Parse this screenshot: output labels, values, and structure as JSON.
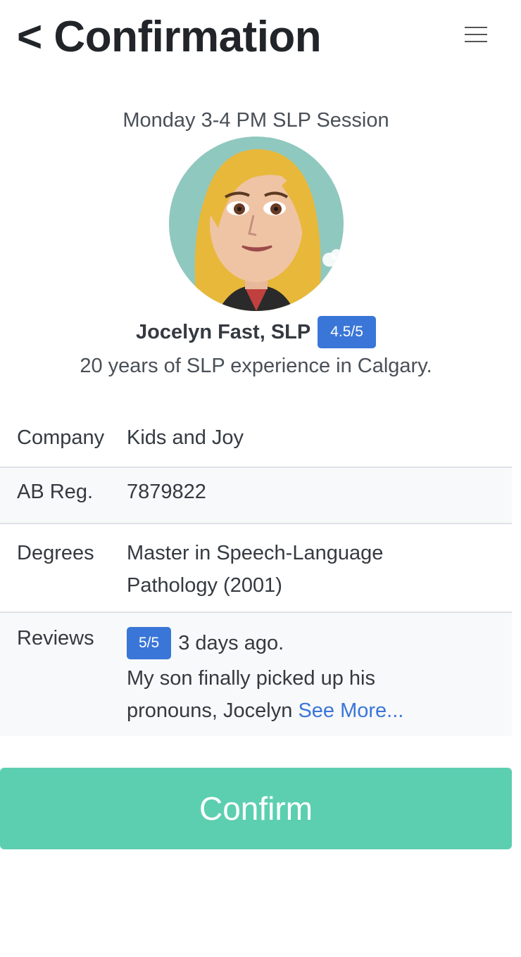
{
  "header": {
    "title": "< Confirmation",
    "menu_icon": "hamburger-menu-icon"
  },
  "session": {
    "title": "Monday 3-4 PM SLP Session"
  },
  "provider": {
    "name": "Jocelyn Fast, SLP",
    "rating": "4.5/5",
    "experience": "20 years of SLP experience in Calgary.",
    "avatar": "cartoon-avatar-blonde-woman"
  },
  "details": {
    "company_label": "Company",
    "company_value": "Kids and Joy",
    "reg_label": "AB Reg.",
    "reg_value": "7879822",
    "degrees_label": "Degrees",
    "degrees_value": "Master in Speech-Language Pathology (2001)",
    "reviews_label": "Reviews",
    "review_rating": "5/5",
    "review_time": "3 days ago.",
    "review_text": "My son finally picked up his pronouns, Jocelyn",
    "see_more": "See More..."
  },
  "actions": {
    "confirm_label": "Confirm"
  },
  "colors": {
    "badge": "#3a76d8",
    "confirm": "#5dcfb1",
    "stripe": "#f8f9fa"
  }
}
